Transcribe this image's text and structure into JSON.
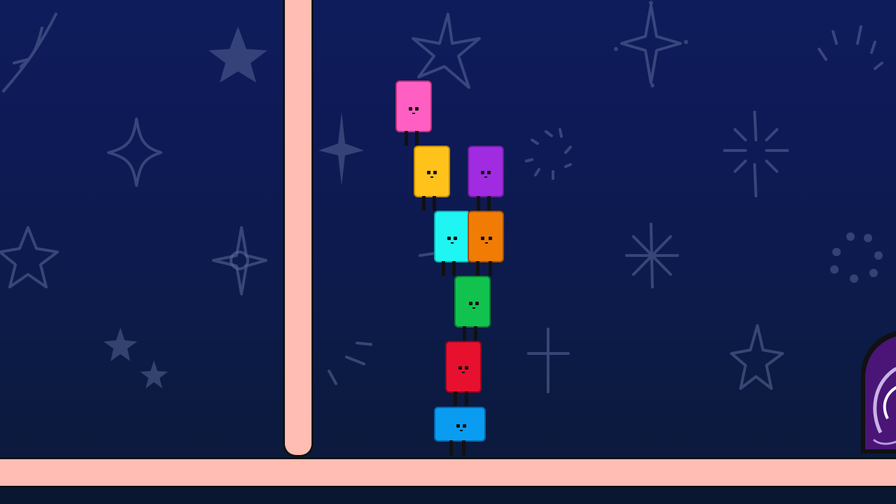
{
  "level": {
    "background_color": "#0e1a55",
    "wall_color": "#ffbdb3",
    "portal_color": "#5a1a8a"
  },
  "characters": [
    {
      "name": "pink",
      "color": "#ff5fc2"
    },
    {
      "name": "yellow",
      "color": "#ffc21a"
    },
    {
      "name": "purple",
      "color": "#a02be0"
    },
    {
      "name": "cyan",
      "color": "#1ff6f4"
    },
    {
      "name": "orange",
      "color": "#f07c05"
    },
    {
      "name": "green",
      "color": "#12c24f"
    },
    {
      "name": "red",
      "color": "#e8102f"
    },
    {
      "name": "blue",
      "color": "#0a9cf0"
    }
  ]
}
